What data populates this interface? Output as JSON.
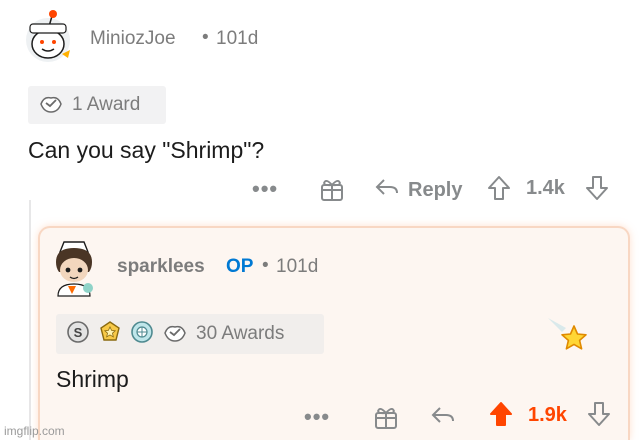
{
  "parent": {
    "username": "MiniozJoe",
    "separator": "•",
    "age": "101d",
    "awards_label": "1 Award",
    "body": "Can you say \"Shrimp\"?",
    "more": "•••",
    "reply_label": "Reply",
    "score": "1.4k"
  },
  "reply": {
    "username": "sparklees",
    "op_tag": "OP",
    "separator": "•",
    "age": "101d",
    "awards_label": "30 Awards",
    "body": "Shrimp",
    "more": "•••",
    "score": "1.9k",
    "upvoted": true
  },
  "colors": {
    "upvote_active": "#ff4500",
    "op_blue": "#0079d3",
    "meta_gray": "#7c7c7c",
    "action_gray": "#878a8c",
    "reply_card_bg": "#fdf6f1",
    "reply_card_border": "#f8d7c3"
  },
  "icons": {
    "parent_awards": [
      "wholesome-award-icon"
    ],
    "reply_awards": [
      "silver-award-icon",
      "gold-award-icon",
      "platinum-award-icon",
      "wholesome-award-icon"
    ],
    "actions": [
      "more-icon",
      "give-award-icon",
      "reply-icon",
      "upvote-icon",
      "downvote-icon"
    ],
    "misc": [
      "gilded-star-sparkle-icon"
    ]
  },
  "watermark": "imgflip.com"
}
